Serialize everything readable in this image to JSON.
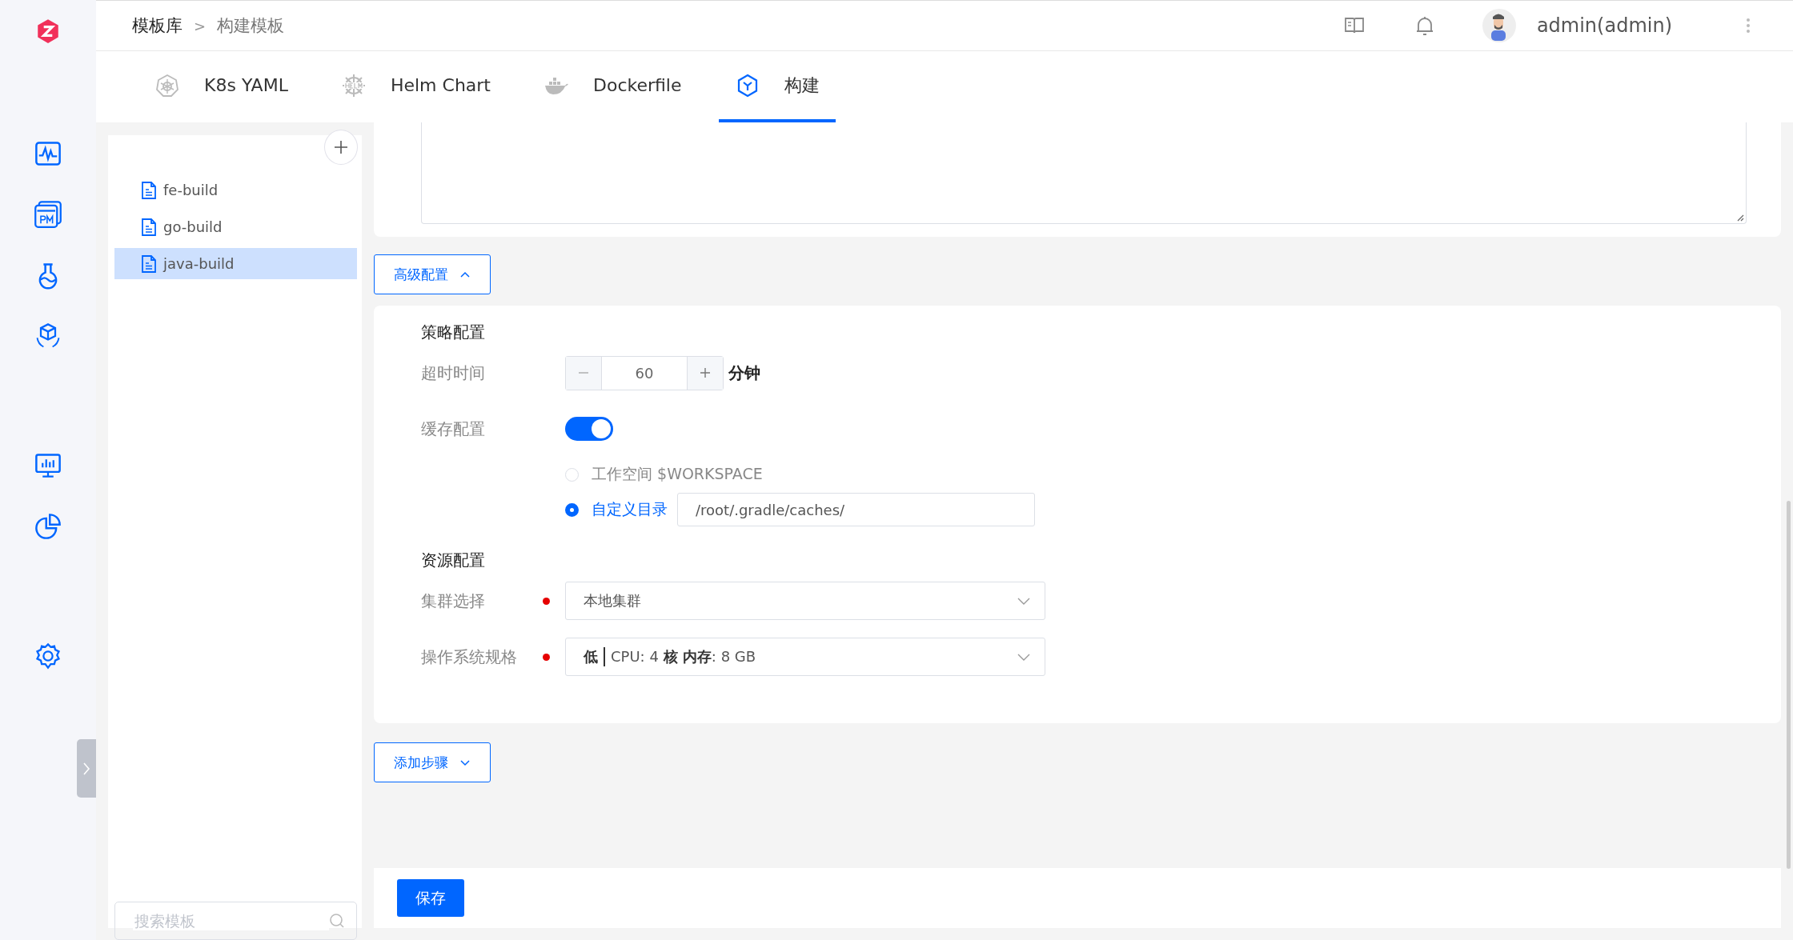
{
  "breadcrumb": [
    {
      "label": "模板库"
    },
    {
      "label": "构建模板"
    }
  ],
  "breadcrumb_separator": ">",
  "user": {
    "name": "admin(admin)"
  },
  "tabs": [
    {
      "label": "K8s YAML",
      "kind": "k8s",
      "selected": false
    },
    {
      "label": "Helm Chart",
      "kind": "helm",
      "selected": false
    },
    {
      "label": "Dockerfile",
      "kind": "docker",
      "selected": false
    },
    {
      "label": "构建",
      "kind": "build",
      "selected": true
    }
  ],
  "templates": [
    {
      "name": "fe-build",
      "selected": false
    },
    {
      "name": "go-build",
      "selected": false
    },
    {
      "name": "java-build",
      "selected": true
    }
  ],
  "search": {
    "placeholder": "搜索模板"
  },
  "advanced_button": {
    "label": "高级配置",
    "expanded": true
  },
  "strategy": {
    "title": "策略配置",
    "timeout": {
      "label": "超时时间",
      "value": "60",
      "unit": "分钟"
    },
    "cache": {
      "label": "缓存配置",
      "on": true,
      "options": [
        {
          "label": "工作空间 $WORKSPACE",
          "selected": false
        },
        {
          "label": "自定义目录",
          "selected": true,
          "value": "/root/.gradle/caches/"
        }
      ]
    }
  },
  "resources": {
    "title": "资源配置",
    "fields": [
      {
        "label": "集群选择",
        "required": true,
        "value": "本地集群"
      },
      {
        "label": "操作系统规格",
        "required": true,
        "level": "低",
        "value": "CPU: 4 **核 内存**: 8 GB"
      }
    ]
  },
  "add_step_button": {
    "label": "添加步骤"
  },
  "save_button": {
    "label": "保存"
  }
}
